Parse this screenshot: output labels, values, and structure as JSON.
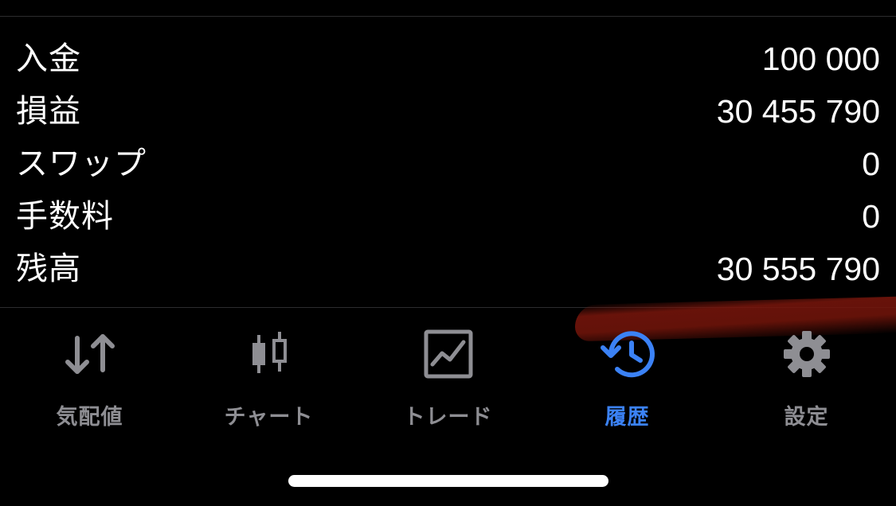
{
  "summary": {
    "rows": [
      {
        "label": "入金",
        "value": "100 000"
      },
      {
        "label": "損益",
        "value": "30 455 790"
      },
      {
        "label": "スワップ",
        "value": "0"
      },
      {
        "label": "手数料",
        "value": "0"
      },
      {
        "label": "残高",
        "value": "30 555 790"
      }
    ]
  },
  "tabbar": {
    "tabs": [
      {
        "label": "気配値",
        "icon": "up-down-arrows-icon",
        "active": false
      },
      {
        "label": "チャート",
        "icon": "candlestick-icon",
        "active": false
      },
      {
        "label": "トレード",
        "icon": "line-chart-icon",
        "active": false
      },
      {
        "label": "履歴",
        "icon": "history-clock-icon",
        "active": true
      },
      {
        "label": "設定",
        "icon": "gear-icon",
        "active": false
      }
    ]
  },
  "colors": {
    "background": "#000000",
    "text": "#ffffff",
    "inactive": "#8e8e93",
    "accent": "#3b82f6",
    "divider": "#2c2c2e"
  }
}
